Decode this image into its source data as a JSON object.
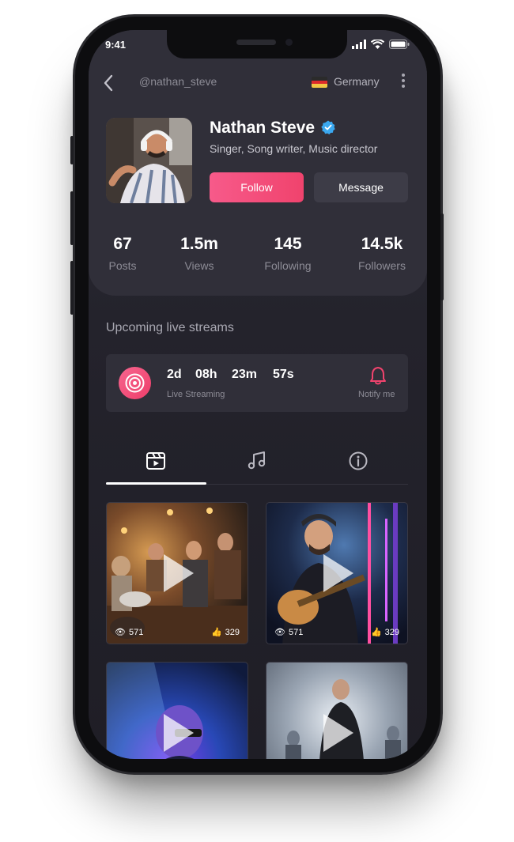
{
  "status_bar": {
    "time": "9:41"
  },
  "header": {
    "username": "@nathan_steve",
    "country": "Germany"
  },
  "profile": {
    "name": "Nathan Steve",
    "bio": "Singer, Song writer, Music director",
    "follow_label": "Follow",
    "message_label": "Message"
  },
  "stats": [
    {
      "value": "67",
      "label": "Posts"
    },
    {
      "value": "1.5m",
      "label": "Views"
    },
    {
      "value": "145",
      "label": "Following"
    },
    {
      "value": "14.5k",
      "label": "Followers"
    }
  ],
  "live": {
    "section_title": "Upcoming live streams",
    "days": "2d",
    "hours": "08h",
    "minutes": "23m",
    "seconds": "57s",
    "subtitle": "Live Streaming",
    "notify_label": "Notify me"
  },
  "tabs": [
    {
      "icon": "video-icon",
      "active": true
    },
    {
      "icon": "music-note-icon",
      "active": false
    },
    {
      "icon": "info-icon",
      "active": false
    }
  ],
  "videos": [
    {
      "views": "571",
      "likes": "329"
    },
    {
      "views": "571",
      "likes": "329"
    },
    {
      "views": "",
      "likes": ""
    },
    {
      "views": "",
      "likes": ""
    }
  ],
  "colors": {
    "accent": "#f0436d",
    "background": "#24232c",
    "card": "#302f39",
    "verified": "#3aa8f0"
  }
}
